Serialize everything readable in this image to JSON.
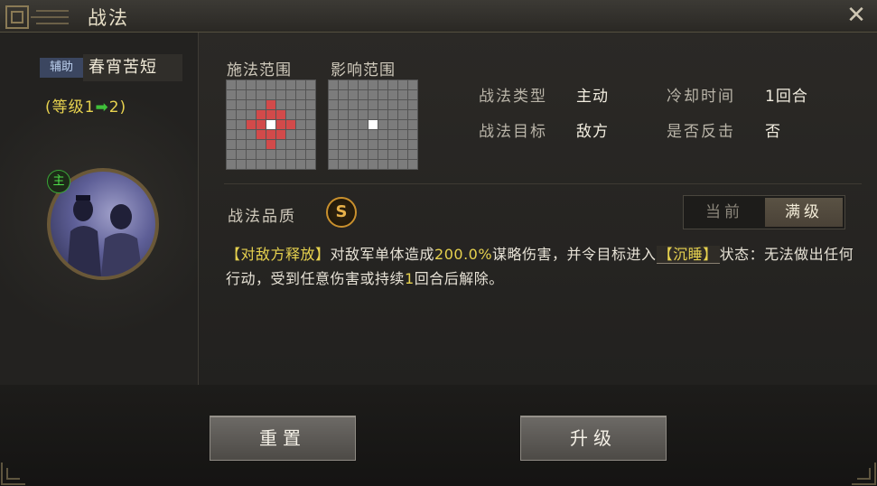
{
  "window": {
    "title": "战法",
    "close_icon": "close-icon"
  },
  "skill": {
    "role_tag": "辅助",
    "name": "春宵苦短",
    "level_prefix": "(等级1",
    "level_suffix": "2)",
    "main_badge": "主"
  },
  "range": {
    "cast_label": "施法范围",
    "effect_label": "影响范围"
  },
  "info": {
    "type_label": "战法类型",
    "type_value": "主动",
    "cooldown_label": "冷却时间",
    "cooldown_value": "1回合",
    "target_label": "战法目标",
    "target_value": "敌方",
    "counter_label": "是否反击",
    "counter_value": "否"
  },
  "quality": {
    "label": "战法品质",
    "grade": "S"
  },
  "toggle": {
    "current": "当前",
    "max": "满级"
  },
  "description": {
    "p1": "【对敌方释放】",
    "p2": "对敌军单体造成",
    "p3": "200.0%",
    "p4": "谋略伤害，并令目标进入",
    "p5": "【沉睡】",
    "p6": "状态：无法做出任何行动，受到任意伤害或持续",
    "p7": "1",
    "p8": "回合后解除。"
  },
  "actions": {
    "reset": "重置",
    "upgrade": "升级"
  },
  "colors": {
    "highlight_yellow": "#e7d24f",
    "arrow_green": "#3fbf3a",
    "range_red": "#d24a4a"
  }
}
